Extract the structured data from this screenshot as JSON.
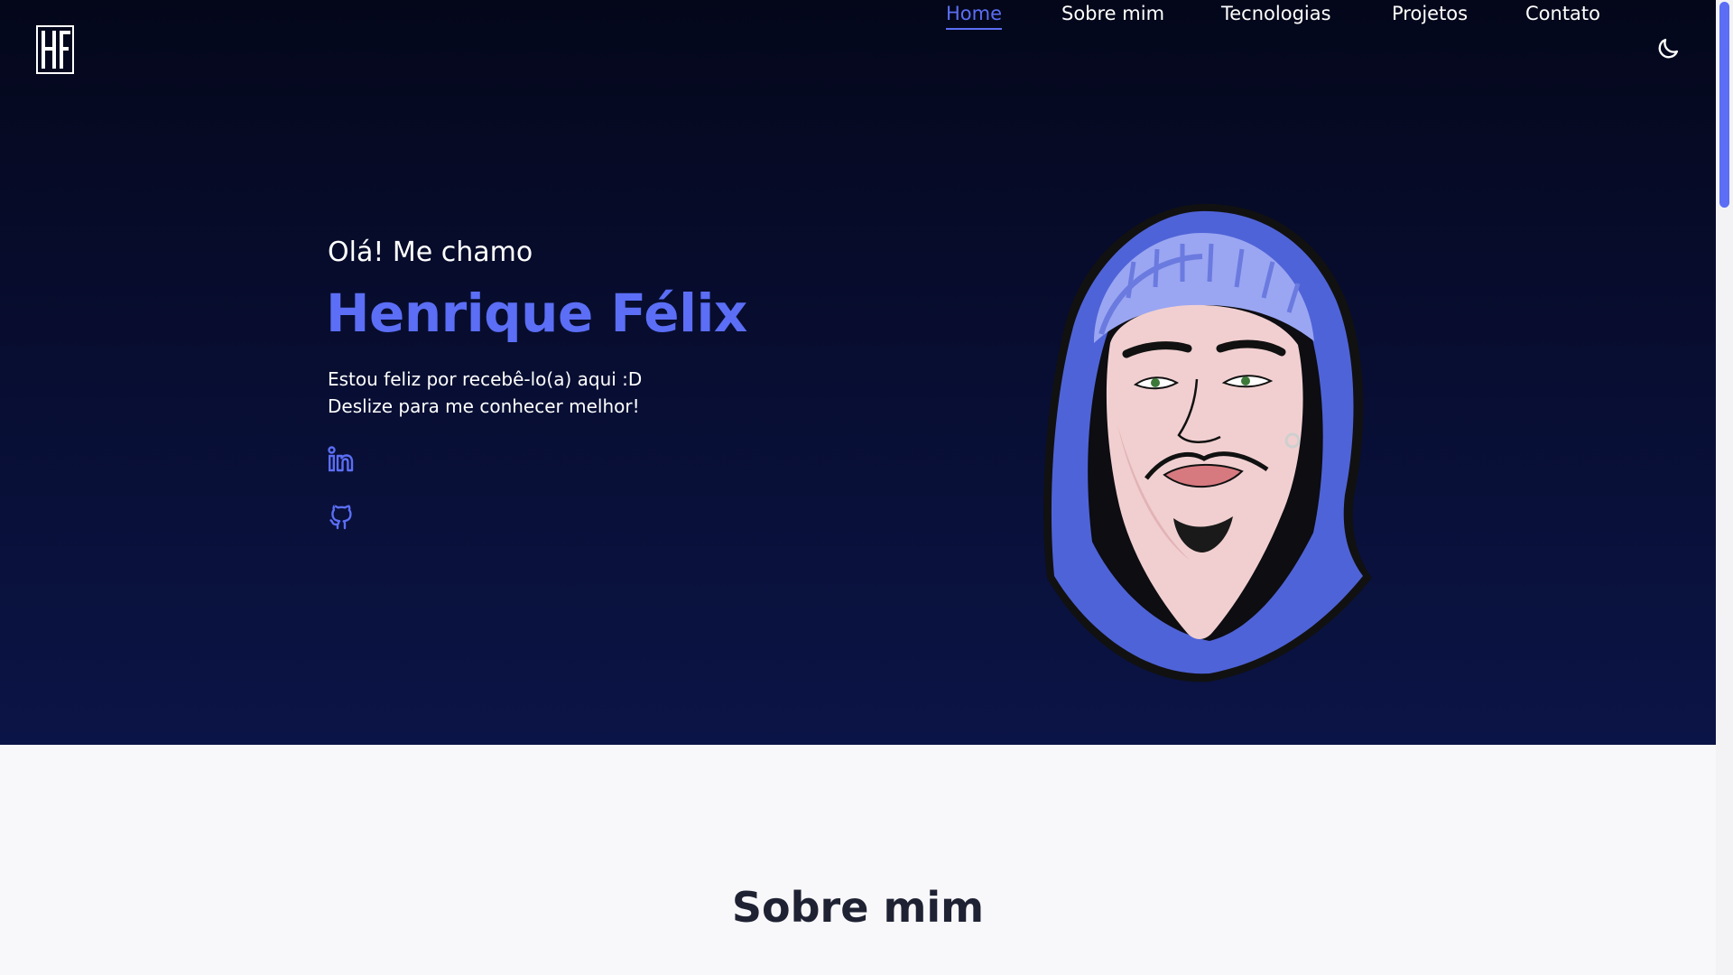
{
  "header": {
    "logo_text": "HF",
    "nav": [
      {
        "label": "Home",
        "active": true
      },
      {
        "label": "Sobre mim",
        "active": false
      },
      {
        "label": "Tecnologias",
        "active": false
      },
      {
        "label": "Projetos",
        "active": false
      },
      {
        "label": "Contato",
        "active": false
      }
    ],
    "theme_icon": "moon-icon"
  },
  "hero": {
    "greeting": "Olá! Me chamo",
    "name": "Henrique Félix",
    "subtitle_line1": "Estou feliz por recebê-lo(a) aqui :D",
    "subtitle_line2": "Deslize para me conhecer melhor!",
    "social": [
      {
        "icon": "linkedin-icon"
      },
      {
        "icon": "github-icon"
      }
    ],
    "avatar": "hooded-portrait-illustration"
  },
  "about": {
    "title": "Sobre mim"
  },
  "colors": {
    "accent": "#5b6ef5",
    "hero_top": "#04071a",
    "hero_bottom": "#0b1446",
    "page_bg": "#f8f8fb",
    "heading": "#1f2233"
  }
}
